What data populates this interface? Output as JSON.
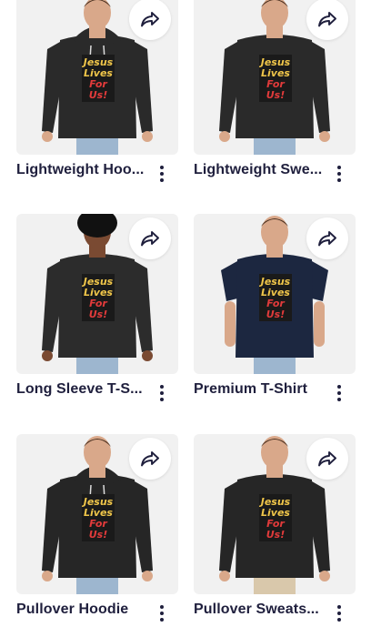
{
  "products": [
    {
      "title": "Lightweight Hoo...",
      "garment": "hoodie",
      "color": "#2a2a2a",
      "share_icon": "share-icon",
      "more_icon": "more-vertical-icon"
    },
    {
      "title": "Lightweight Swe...",
      "garment": "sweatshirt",
      "color": "#2a2a2a",
      "share_icon": "share-icon",
      "more_icon": "more-vertical-icon"
    },
    {
      "title": "Long Sleeve T-S...",
      "garment": "longsleeve",
      "color": "#2c2c2c",
      "share_icon": "share-icon",
      "more_icon": "more-vertical-icon"
    },
    {
      "title": "Premium T-Shirt",
      "garment": "tshirt",
      "color": "#1c2740",
      "share_icon": "share-icon",
      "more_icon": "more-vertical-icon"
    },
    {
      "title": "Pullover Hoodie",
      "garment": "hoodie",
      "color": "#262626",
      "share_icon": "share-icon",
      "more_icon": "more-vertical-icon"
    },
    {
      "title": "Pullover Sweats...",
      "garment": "sweatshirt",
      "color": "#262626",
      "share_icon": "share-icon",
      "more_icon": "more-vertical-icon"
    }
  ],
  "design": {
    "lines": [
      "Jesus",
      "Lives",
      "For",
      "Us!"
    ],
    "colors": [
      "#f0c64a",
      "#f0c64a",
      "#e23b3b",
      "#e23b3b"
    ]
  },
  "theme": {
    "text_color": "#1f1f3d",
    "thumb_bg": "#f1f1f1"
  }
}
